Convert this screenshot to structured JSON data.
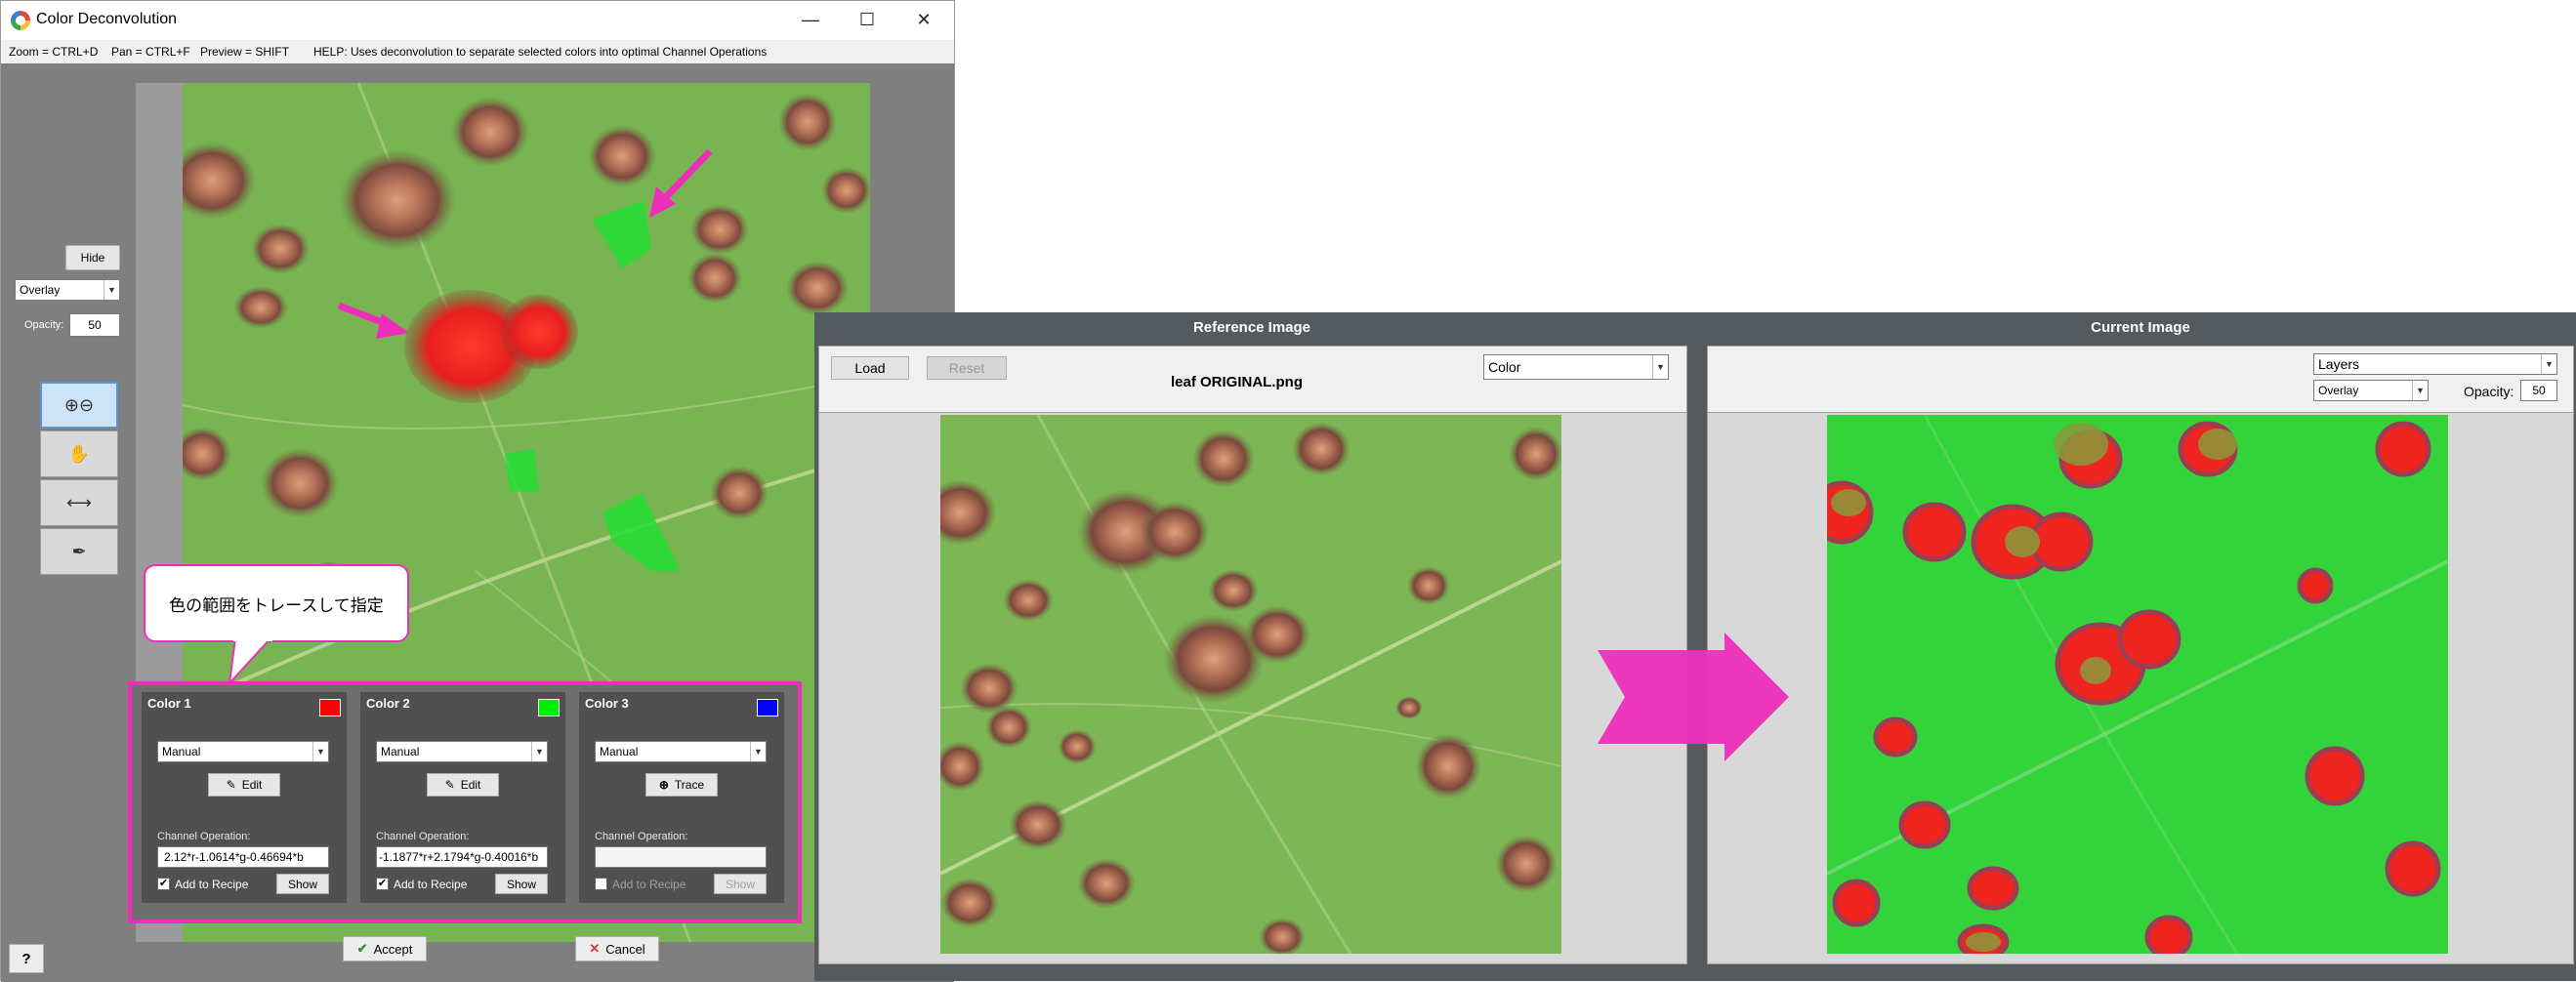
{
  "window": {
    "title": "Color Deconvolution",
    "minimize": "—",
    "maximize": "☐",
    "close": "✕"
  },
  "hints": {
    "zoom": "Zoom = CTRL+D",
    "pan": "Pan = CTRL+F",
    "preview": "Preview = SHIFT",
    "help": "HELP:  Uses deconvolution to separate selected colors into optimal Channel Operations"
  },
  "sidebar": {
    "hide_label": "Hide",
    "mode_value": "Overlay",
    "opacity_label": "Opacity:",
    "opacity_value": "50",
    "tools": [
      "zoom-tool",
      "pan-tool",
      "measure-tool",
      "eyedropper-tool"
    ]
  },
  "callout": {
    "text": "色の範囲をトレースして指定"
  },
  "colors": [
    {
      "title": "Color 1",
      "swatch": "#ff0000",
      "mode": "Manual",
      "action_label": "Edit",
      "op_label": "Channel Operation:",
      "op_value": "2.12*r-1.0614*g-0.46694*b",
      "add_label": "Add to Recipe",
      "add_checked": "✔",
      "show_label": "Show"
    },
    {
      "title": "Color 2",
      "swatch": "#00ee00",
      "mode": "Manual",
      "action_label": "Edit",
      "op_label": "Channel Operation:",
      "op_value": "-1.1877*r+2.1794*g-0.40016*b",
      "add_label": "Add to Recipe",
      "add_checked": "✔",
      "show_label": "Show"
    },
    {
      "title": "Color 3",
      "swatch": "#0000ff",
      "mode": "Manual",
      "action_label": "Trace",
      "op_label": "Channel Operation:",
      "op_value": "",
      "add_label": "Add to Recipe",
      "add_checked": "",
      "show_label": "Show"
    }
  ],
  "footer": {
    "accept_label": "Accept",
    "cancel_label": "Cancel",
    "help_label": "?"
  },
  "reference": {
    "title": "Reference Image",
    "load_label": "Load",
    "reset_label": "Reset",
    "filename": "leaf ORIGINAL.png",
    "mode_value": "Color"
  },
  "current": {
    "title": "Current Image",
    "layers_value": "Layers",
    "overlay_value": "Overlay",
    "opacity_label": "Opacity:",
    "opacity_value": "50"
  },
  "accent_color": "#ee2ebb"
}
